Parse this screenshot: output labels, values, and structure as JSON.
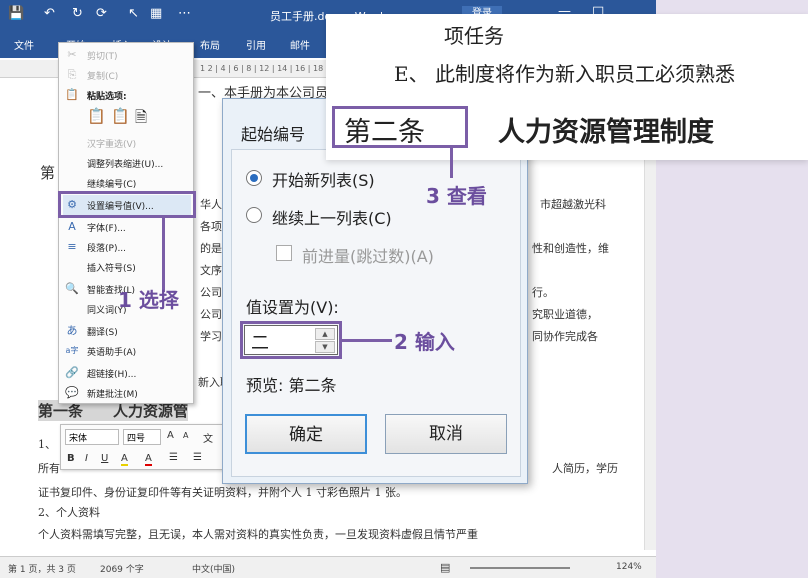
{
  "window": {
    "title": "员工手册.docx - Word",
    "login": "登录",
    "controls": {
      "minimize": "—",
      "maximize": "□"
    }
  },
  "quick_access": [
    "💾",
    "↶",
    "↻",
    "⟳",
    "↖",
    "▦",
    "⋯"
  ],
  "ribbon_tabs": [
    "文件",
    "开始",
    "插入",
    "设计",
    "布局",
    "引用",
    "邮件"
  ],
  "ruler_ticks": "1 2 | 4 | 6 | 8 | 12 | 14 | 16 | 18 | 20 | 22 | 24 | 26 | 28 | 30 | 32 | 34 | 36 | 38",
  "document": {
    "top_line": "一、本手册为本公司员工必须遵守的条例",
    "left_fragments": [
      "第",
      "华人",
      "各项规",
      "的是",
      "文序,",
      "公司",
      "公司的",
      "学习"
    ],
    "right_fragments": [
      "市超越激光科",
      "性和创造性，维",
      "行。",
      "究职业道德，",
      "同协作完成各"
    ],
    "frag_intro": "新入职",
    "heading": "第一条　　人力资源管",
    "line_1": "1、",
    "line_all": "所有",
    "right_resume": "人简历，学历",
    "line_cert": "证书复印件、身份证复印件等有关证明资料，并附个人 1 寸彩色照片 1 张。",
    "line_2": "2、个人资料",
    "line_last": "个人资料需填写完整，且无误，本人需对资料的真实性负责，一旦发现资料虚假且情节严重"
  },
  "context_menu": [
    {
      "icon": "✂",
      "label": "剪切(T)",
      "disabled": true
    },
    {
      "icon": "⎘",
      "label": "复制(C)",
      "disabled": true
    },
    {
      "icon": "📋",
      "label": "粘贴选项:",
      "disabled": false
    },
    {
      "icon": "",
      "label": "",
      "disabled": false
    },
    {
      "icon": "",
      "label": "汉字重选(V)",
      "disabled": true
    },
    {
      "icon": "",
      "label": "调整列表缩进(U)...",
      "disabled": false
    },
    {
      "icon": "",
      "label": "继续编号(C)",
      "disabled": false
    },
    {
      "icon": "⚙",
      "label": "设置编号值(V)...",
      "disabled": false
    },
    {
      "icon": "A",
      "label": "字体(F)...",
      "disabled": false
    },
    {
      "icon": "≡",
      "label": "段落(P)...",
      "disabled": false
    },
    {
      "icon": "",
      "label": "插入符号(S)",
      "disabled": false
    },
    {
      "icon": "🔍",
      "label": "智能查找(L)",
      "disabled": false
    },
    {
      "icon": "",
      "label": "同义词(Y)",
      "disabled": false
    },
    {
      "icon": "あ",
      "label": "翻译(S)",
      "disabled": false
    },
    {
      "icon": "a字",
      "label": "英语助手(A)",
      "disabled": false
    },
    {
      "icon": "🔗",
      "label": "超链接(H)...",
      "disabled": false
    },
    {
      "icon": "💬",
      "label": "新建批注(M)",
      "disabled": false
    }
  ],
  "mini_toolbar": {
    "font": "宋体",
    "size": "四号",
    "buttons": [
      "A",
      "A",
      "文",
      "B",
      "I",
      "U",
      "A",
      "A",
      "☰",
      "☰"
    ]
  },
  "dialog": {
    "title": "起始编号",
    "opt_new": "开始新列表(S)",
    "opt_continue": "继续上一列表(C)",
    "opt_advance": "前进量(跳过数)(A)",
    "value_label": "值设置为(V):",
    "value": "二",
    "preview": "预览: 第二条",
    "ok": "确定",
    "cancel": "取消"
  },
  "zoom": {
    "line1": "项任务",
    "line2": "E、 此制度将作为新入职员工必须熟悉",
    "box_text": "第二条",
    "heading": "人力资源管理制度"
  },
  "callouts": {
    "one": "1 选择",
    "two": "2 输入",
    "three": "3 查看"
  },
  "status": {
    "page": "第 1 页，共 3 页",
    "words": "2069 个字",
    "lang": "中文(中国)",
    "zoom": "124%"
  },
  "colors": {
    "accent": "#7b5ea7",
    "word_blue": "#2b579a"
  }
}
